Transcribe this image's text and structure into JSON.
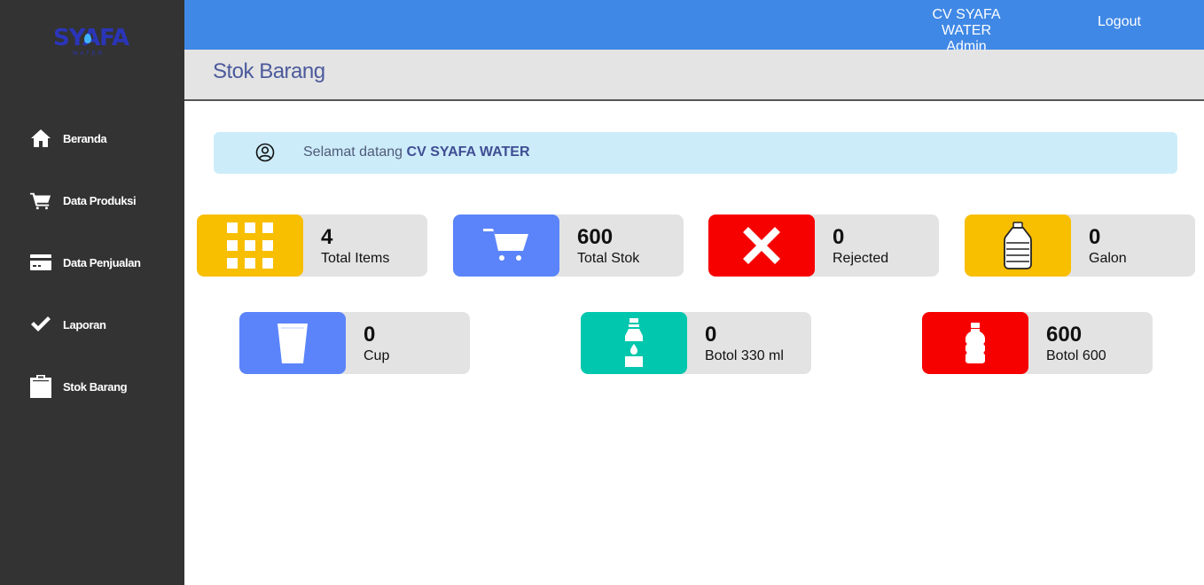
{
  "logo": {
    "text": "SYAFA",
    "sub": "WATER"
  },
  "sidebar": {
    "items": [
      {
        "label": "Beranda",
        "icon": "home-icon"
      },
      {
        "label": "Data Produksi",
        "icon": "cart-icon"
      },
      {
        "label": "Data Penjualan",
        "icon": "credit-card-icon"
      },
      {
        "label": "Laporan",
        "icon": "check-icon"
      },
      {
        "label": "Stok Barang",
        "icon": "clipboard-icon"
      }
    ]
  },
  "header": {
    "company": "CV SYAFA WATER",
    "role": "Admin",
    "logout_label": "Logout"
  },
  "page": {
    "title": "Stok Barang"
  },
  "welcome": {
    "prefix": "Selamat datang",
    "name": "CV SYAFA WATER"
  },
  "colors": {
    "sidebar": "#333333",
    "topbar": "#3f88e6",
    "yellow": "#f8be00",
    "blue": "#5b84fb",
    "red": "#f70000",
    "teal": "#00c7ad",
    "card_bg": "#e3e3e3",
    "welcome_bg": "#ccecfa"
  },
  "cards": [
    {
      "value": "4",
      "label": "Total Items",
      "icon": "grid-icon",
      "color": "#f8be00"
    },
    {
      "value": "600",
      "label": "Total Stok",
      "icon": "cart-icon",
      "color": "#5b84fb"
    },
    {
      "value": "0",
      "label": "Rejected",
      "icon": "x-icon",
      "color": "#f70000"
    },
    {
      "value": "0",
      "label": "Galon",
      "icon": "gallon-icon",
      "color": "#f8be00"
    },
    {
      "value": "0",
      "label": "Cup",
      "icon": "cup-icon",
      "color": "#5b84fb"
    },
    {
      "value": "0",
      "label": "Botol 330 ml",
      "icon": "bottle-icon",
      "color": "#00c7ad"
    },
    {
      "value": "600",
      "label": "Botol 600",
      "icon": "bottle-icon",
      "color": "#f70000"
    }
  ]
}
